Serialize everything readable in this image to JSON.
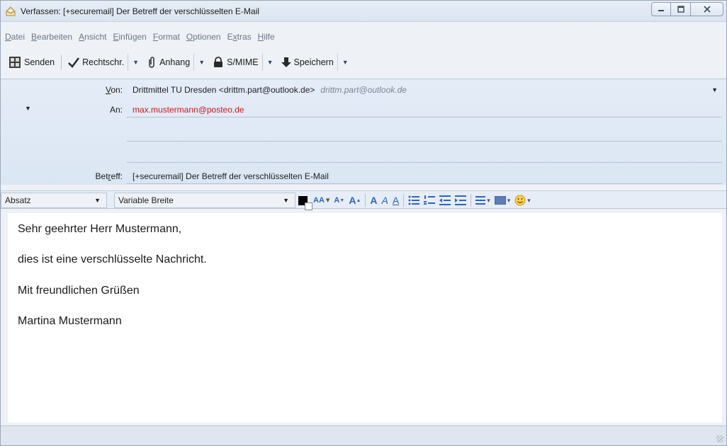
{
  "window": {
    "title": "Verfassen: [+securemail] Der Betreff der verschlüsselten E-Mail",
    "controls": {
      "minimize": "▭",
      "maximize": "▣",
      "close": "✕"
    }
  },
  "menu": {
    "items": [
      {
        "u": "D",
        "rest": "atei"
      },
      {
        "u": "B",
        "rest": "earbeiten"
      },
      {
        "u": "A",
        "rest": "nsicht"
      },
      {
        "u": "E",
        "rest": "infügen"
      },
      {
        "u": "F",
        "rest": "ormat"
      },
      {
        "u": "O",
        "rest": "ptionen"
      },
      {
        "pre": "E",
        "u": "x",
        "rest": "tras"
      },
      {
        "u": "H",
        "rest": "ilfe"
      }
    ]
  },
  "toolbar": {
    "send_label": "Senden",
    "spell_label": "Rechtschr.",
    "attach_label": "Anhang",
    "smime_label": "S/MIME",
    "save_label": "Speichern",
    "dropdown_glyph": "▼"
  },
  "header": {
    "from_label_u": "V",
    "from_label_rest": "on:",
    "from_value": "Drittmittel TU Dresden <drittm.part@outlook.de>",
    "from_secondary": "drittm.part@outlook.de",
    "to_label": "An:",
    "to_value": "max.mustermann@posteo.de",
    "subject_label_pre": "Bet",
    "subject_label_u": "r",
    "subject_label_rest": "eff:",
    "subject_value": "[+securemail] Der Betreff der verschlüsselten E-Mail"
  },
  "formatbar": {
    "paragraph_value": "Absatz",
    "font_value": "Variable Breite",
    "tools": {
      "smaller": "AA",
      "size_down": "A",
      "size_up": "A",
      "bold": "A",
      "italic": "A",
      "underline": "A"
    },
    "accent_color": "#2d63c3"
  },
  "body": {
    "lines": [
      "Sehr geehrter Herr Mustermann,",
      "dies ist eine verschlüsselte Nachricht.",
      "Mit freundlichen Grüßen",
      "Martina Mustermann"
    ]
  }
}
